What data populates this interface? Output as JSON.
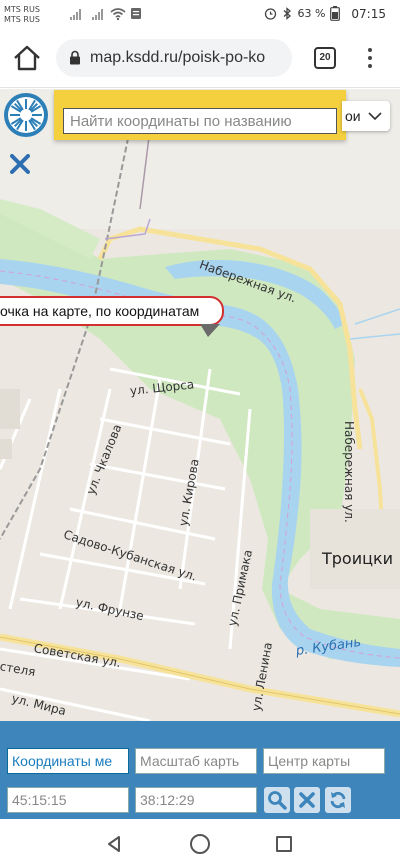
{
  "statusbar": {
    "carrier1": "MTS RUS",
    "carrier2": "MTS RUS",
    "battery": "63 %",
    "time": "07:15"
  },
  "browser": {
    "url": "map.ksdd.ru/poisk-po-ko",
    "tab_count": "20"
  },
  "map": {
    "search_placeholder": "Найти координаты по названию",
    "layer_label": "ои",
    "tooltip": "очка на карте, по координатам",
    "labels": {
      "naberezhnaya_top": "Набережная ул.",
      "naberezhnaya_right": "Набережная ул.",
      "schorsa": "ул. Щорса",
      "chkalova": "ул. Чкалова",
      "kirova": "ул. Кирова",
      "sadovo": "Садово-Кубанская ул.",
      "primaka": "ул. Примака",
      "frunze": "ул. Фрунзе",
      "sovetskaya": "Советская ул.",
      "lenina": "ул. Ленина",
      "kuban": "р. Кубань",
      "troitsky": "Троицки",
      "stelya": "стеля",
      "mira": "ул. Мира"
    }
  },
  "panel": {
    "coords_placeholder": "Координаты ме",
    "scale_placeholder": "Масштаб карть",
    "center_placeholder": "Центр карты",
    "lat_value": "45:15:15",
    "lon_value": "38:12:29"
  },
  "colors": {
    "panel_bg": "#3e85bb",
    "search_bg": "#f4d03f",
    "tooltip_border": "#d32f2f",
    "river": "#a8d4f0",
    "green": "#cfe8c0"
  },
  "icons": {
    "home": "home-icon",
    "lock": "lock-icon",
    "menu": "more-vert-icon",
    "close": "close-icon",
    "search": "search-icon",
    "clear": "clear-icon",
    "refresh": "refresh-icon"
  }
}
